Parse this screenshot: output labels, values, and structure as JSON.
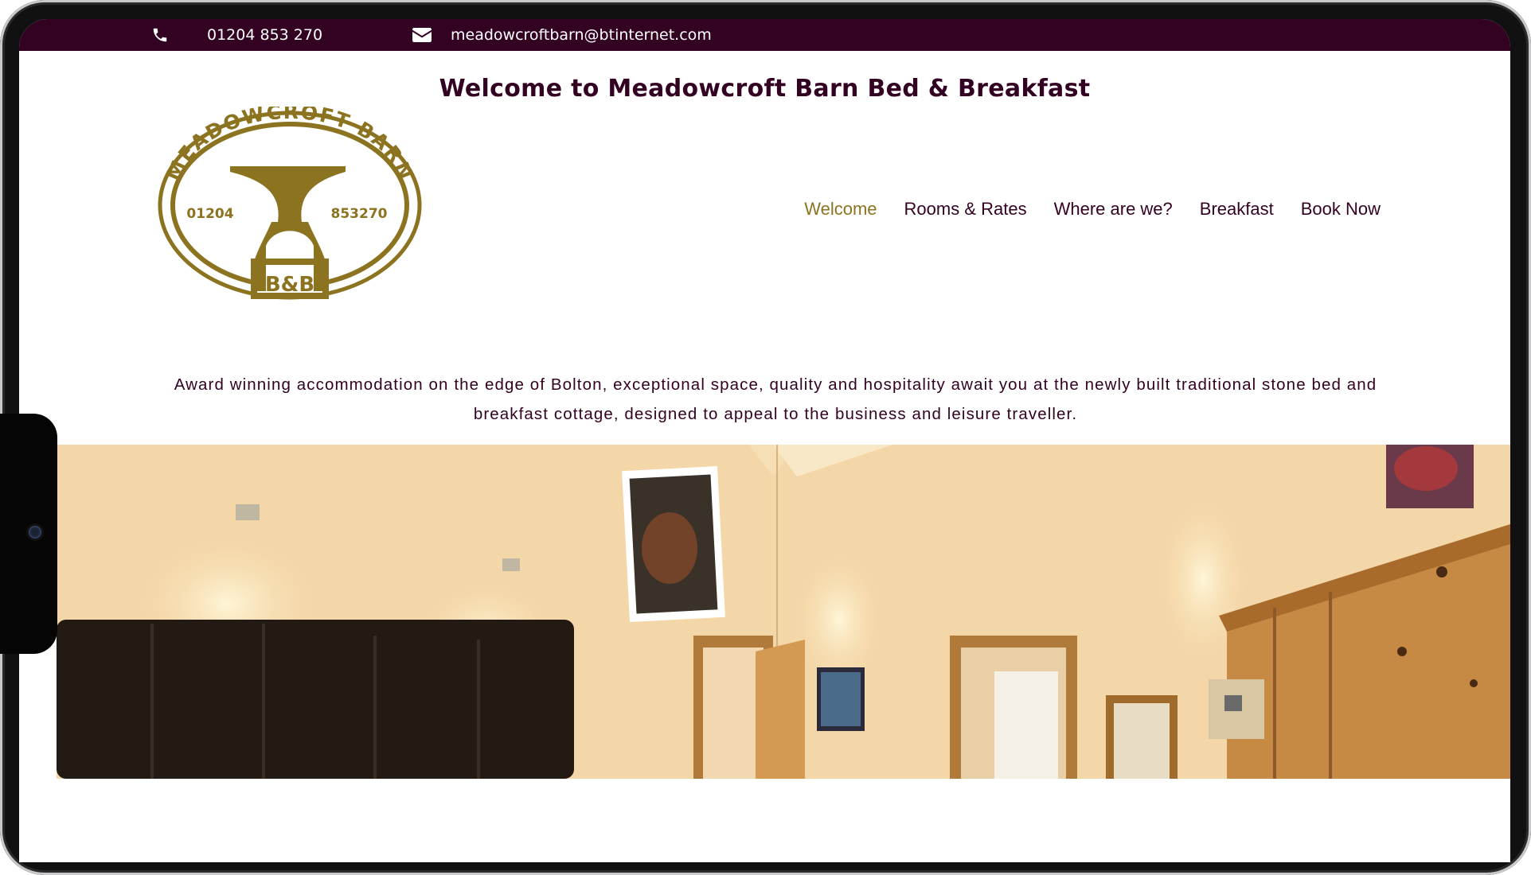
{
  "topbar": {
    "phone_icon": "phone-icon",
    "phone": "01204 853 270",
    "email_icon": "envelope-icon",
    "email": "meadowcroftbarn@btinternet.com"
  },
  "header": {
    "title": "Welcome to Meadowcroft Barn Bed & Breakfast"
  },
  "logo": {
    "arc_text": "MEADOWCROFT BARN",
    "left_text": "01204",
    "right_text": "853270",
    "bottom_text": "B&B"
  },
  "nav": {
    "items": [
      {
        "label": "Welcome",
        "active": true
      },
      {
        "label": "Rooms & Rates",
        "active": false
      },
      {
        "label": "Where are we?",
        "active": false
      },
      {
        "label": "Breakfast",
        "active": false
      },
      {
        "label": "Book Now",
        "active": false
      }
    ]
  },
  "intro": {
    "text": "Award winning accommodation on the edge of Bolton, exceptional space, quality and hospitality await you at the newly built traditional stone bed and breakfast cottage, designed to appeal to the business and leisure traveller."
  },
  "colors": {
    "brand": "#330122",
    "accent": "#8c7320"
  }
}
